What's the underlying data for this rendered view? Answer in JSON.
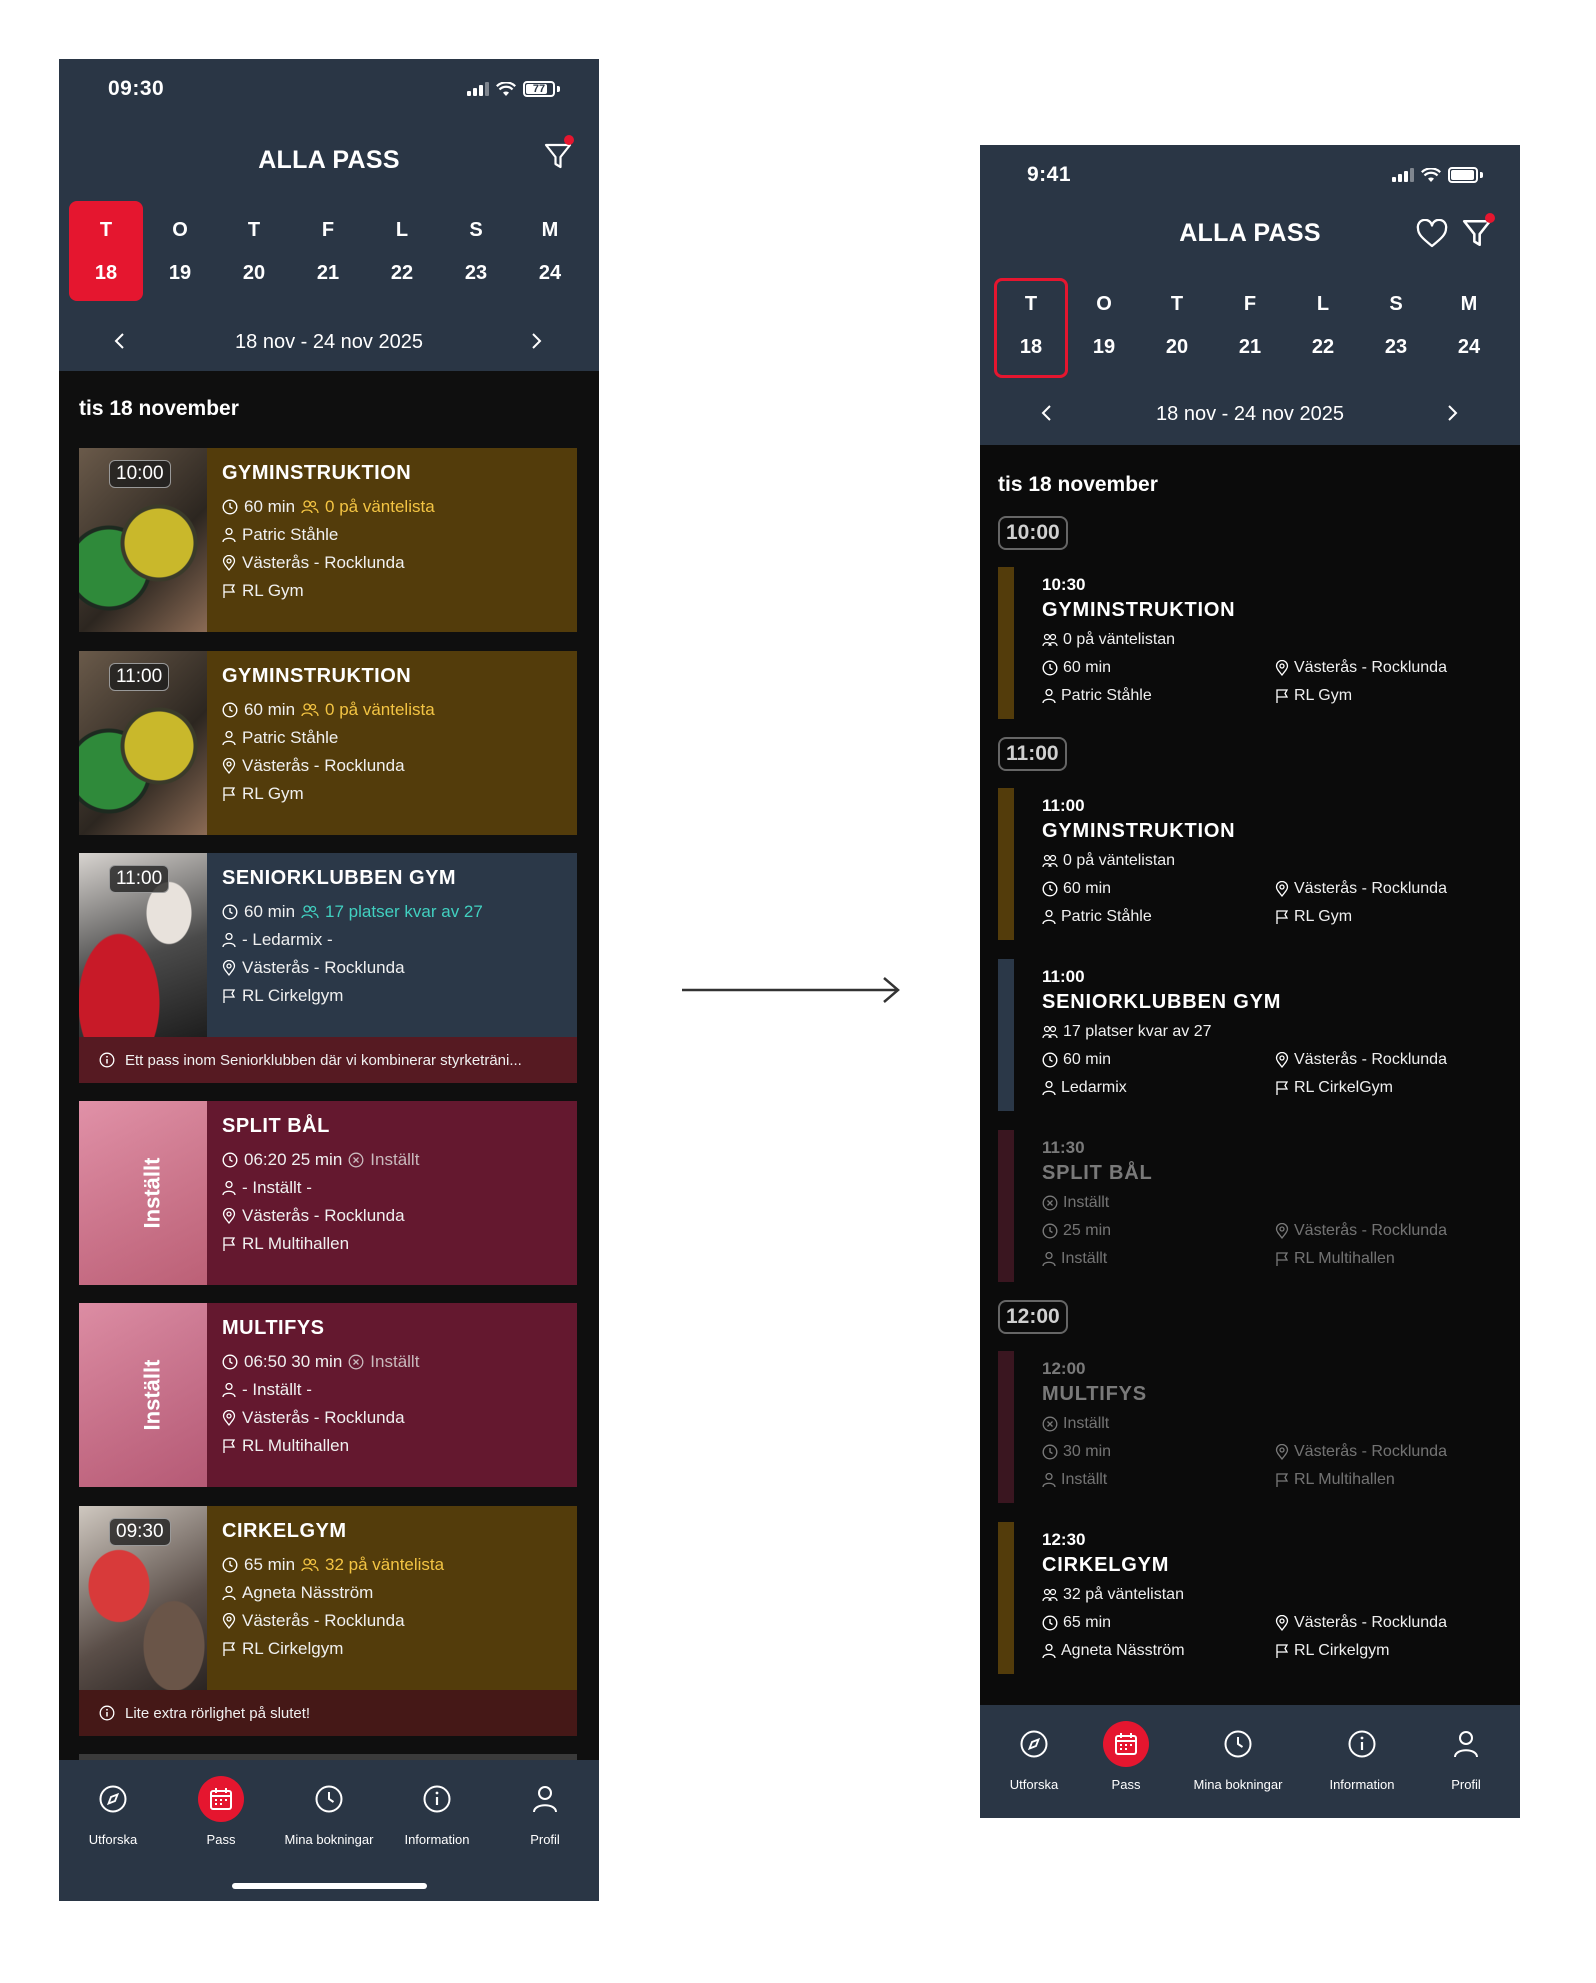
{
  "left": {
    "status": {
      "time": "09:30",
      "battery": "77"
    },
    "title": "ALLA PASS",
    "days": [
      {
        "letter": "T",
        "num": "18",
        "selected": true
      },
      {
        "letter": "O",
        "num": "19"
      },
      {
        "letter": "T",
        "num": "20"
      },
      {
        "letter": "F",
        "num": "21"
      },
      {
        "letter": "L",
        "num": "22"
      },
      {
        "letter": "S",
        "num": "23"
      },
      {
        "letter": "M",
        "num": "24"
      }
    ],
    "week_range": "18 nov - 24 nov 2025",
    "date_heading": "tis 18 november",
    "cards": [
      {
        "badge": "10:00",
        "title": "GYMINSTRUKTION",
        "time": "60 min",
        "status": "0 på väntelista",
        "instructor": "Patric Ståhle",
        "location": "Västerås - Rocklunda",
        "room": "RL Gym"
      },
      {
        "badge": "11:00",
        "title": "GYMINSTRUKTION",
        "time": "60 min",
        "status": "0 på väntelista",
        "instructor": "Patric Ståhle",
        "location": "Västerås - Rocklunda",
        "room": "RL Gym"
      },
      {
        "badge": "11:00",
        "title": "SENIORKLUBBEN GYM",
        "time": "60 min",
        "status": "17 platser kvar av 27",
        "instructor": "- Ledarmix -",
        "location": "Västerås - Rocklunda",
        "room": "RL Cirkelgym",
        "note": "Ett pass inom Seniorklubben där vi kombinerar styrketräni..."
      },
      {
        "badge": "Inställt",
        "title": "SPLIT BÅL",
        "time": "06:20  25 min",
        "status": "Inställt",
        "instructor": "- Inställt -",
        "location": "Västerås - Rocklunda",
        "room": "RL Multihallen"
      },
      {
        "badge": "Inställt",
        "title": "MULTIFYS",
        "time": "06:50  30 min",
        "status": "Inställt",
        "instructor": "- Inställt -",
        "location": "Västerås - Rocklunda",
        "room": "RL Multihallen"
      },
      {
        "badge": "09:30",
        "title": "CIRKELGYM",
        "time": "65 min",
        "status": "32 på väntelista",
        "instructor": "Agneta Näsström",
        "location": "Västerås - Rocklunda",
        "room": "RL Cirkelgym",
        "note": "Lite extra rörlighet på slutet!"
      }
    ],
    "nav": [
      "Utforska",
      "Pass",
      "Mina bokningar",
      "Information",
      "Profil"
    ]
  },
  "right": {
    "status": {
      "time": "9:41"
    },
    "title": "ALLA PASS",
    "days": [
      {
        "letter": "T",
        "num": "18",
        "selected": true
      },
      {
        "letter": "O",
        "num": "19"
      },
      {
        "letter": "T",
        "num": "20"
      },
      {
        "letter": "F",
        "num": "21"
      },
      {
        "letter": "L",
        "num": "22"
      },
      {
        "letter": "S",
        "num": "23"
      },
      {
        "letter": "M",
        "num": "24"
      }
    ],
    "week_range": "18 nov - 24 nov 2025",
    "date_heading": "tis 18 november",
    "slots": [
      "10:00",
      "11:00",
      "12:00"
    ],
    "items": [
      {
        "time": "10:30",
        "title": "GYMINSTRUKTION",
        "status": "0 på väntelistan",
        "duration": "60 min",
        "instructor": "Patric Ståhle",
        "location": "Västerås - Rocklunda",
        "room": "RL Gym"
      },
      {
        "time": "11:00",
        "title": "GYMINSTRUKTION",
        "status": "0 på väntelistan",
        "duration": "60 min",
        "instructor": "Patric Ståhle",
        "location": "Västerås - Rocklunda",
        "room": "RL Gym"
      },
      {
        "time": "11:00",
        "title": "SENIORKLUBBEN GYM",
        "status": "17 platser kvar av 27",
        "duration": "60 min",
        "instructor": "Ledarmix",
        "location": "Västerås - Rocklunda",
        "room": "RL CirkelGym"
      },
      {
        "time": "11:30",
        "title": "SPLIT BÅL",
        "status": "Inställt",
        "duration": "25 min",
        "instructor": "Inställt",
        "location": "Västerås - Rocklunda",
        "room": "RL Multihallen"
      },
      {
        "time": "12:00",
        "title": "MULTIFYS",
        "status": "Inställt",
        "duration": "30 min",
        "instructor": "Inställt",
        "location": "Västerås - Rocklunda",
        "room": "RL Multihallen"
      },
      {
        "time": "12:30",
        "title": "CIRKELGYM",
        "status": "32 på väntelistan",
        "duration": "65 min",
        "instructor": "Agneta Näsström",
        "location": "Västerås - Rocklunda",
        "room": "RL Cirkelgym"
      }
    ],
    "nav": [
      "Utforska",
      "Pass",
      "Mina bokningar",
      "Information",
      "Profil"
    ]
  },
  "colors": {
    "header": "#2a3645",
    "accent_red": "#e5162f",
    "card_gold": "#533c0b",
    "card_slate": "#2b3848",
    "card_wine": "#64182f",
    "waitlist_yellow": "#f3c443",
    "spots_teal": "#41d0c0"
  },
  "icons": [
    "filter-icon",
    "heart-icon",
    "clock-icon",
    "users-icon",
    "person-icon",
    "pin-icon",
    "flag-icon",
    "info-icon",
    "compass-icon",
    "calendar-icon",
    "history-icon",
    "profile-icon",
    "chevron-left-icon",
    "chevron-right-icon",
    "arrow-right-icon"
  ]
}
